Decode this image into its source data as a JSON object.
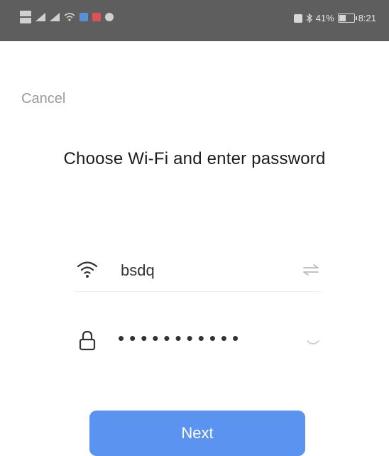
{
  "status_bar": {
    "battery_percent": "41%",
    "battery_level": 0.41,
    "time": "8:21",
    "icons": [
      "sim-icon",
      "signal-icon",
      "signal-icon",
      "wifi-icon",
      "app-icon",
      "app-icon",
      "app-icon",
      "nfc-icon",
      "bluetooth-icon",
      "battery-icon"
    ]
  },
  "sheet": {
    "cancel_label": "Cancel",
    "title": "Choose Wi-Fi and enter password",
    "wifi": {
      "icon": "wifi-icon",
      "ssid": "bsdq",
      "switch_icon": "swap-icon"
    },
    "password": {
      "icon": "lock-icon",
      "masked_value": "•••••••••••",
      "toggle_icon": "eye-closed-icon"
    },
    "next_label": "Next"
  },
  "colors": {
    "status_bar_bg": "#5e5e5e",
    "primary_button": "#5a93f0",
    "title_text": "#1c1c1c",
    "muted_text": "#9a9a9a"
  }
}
